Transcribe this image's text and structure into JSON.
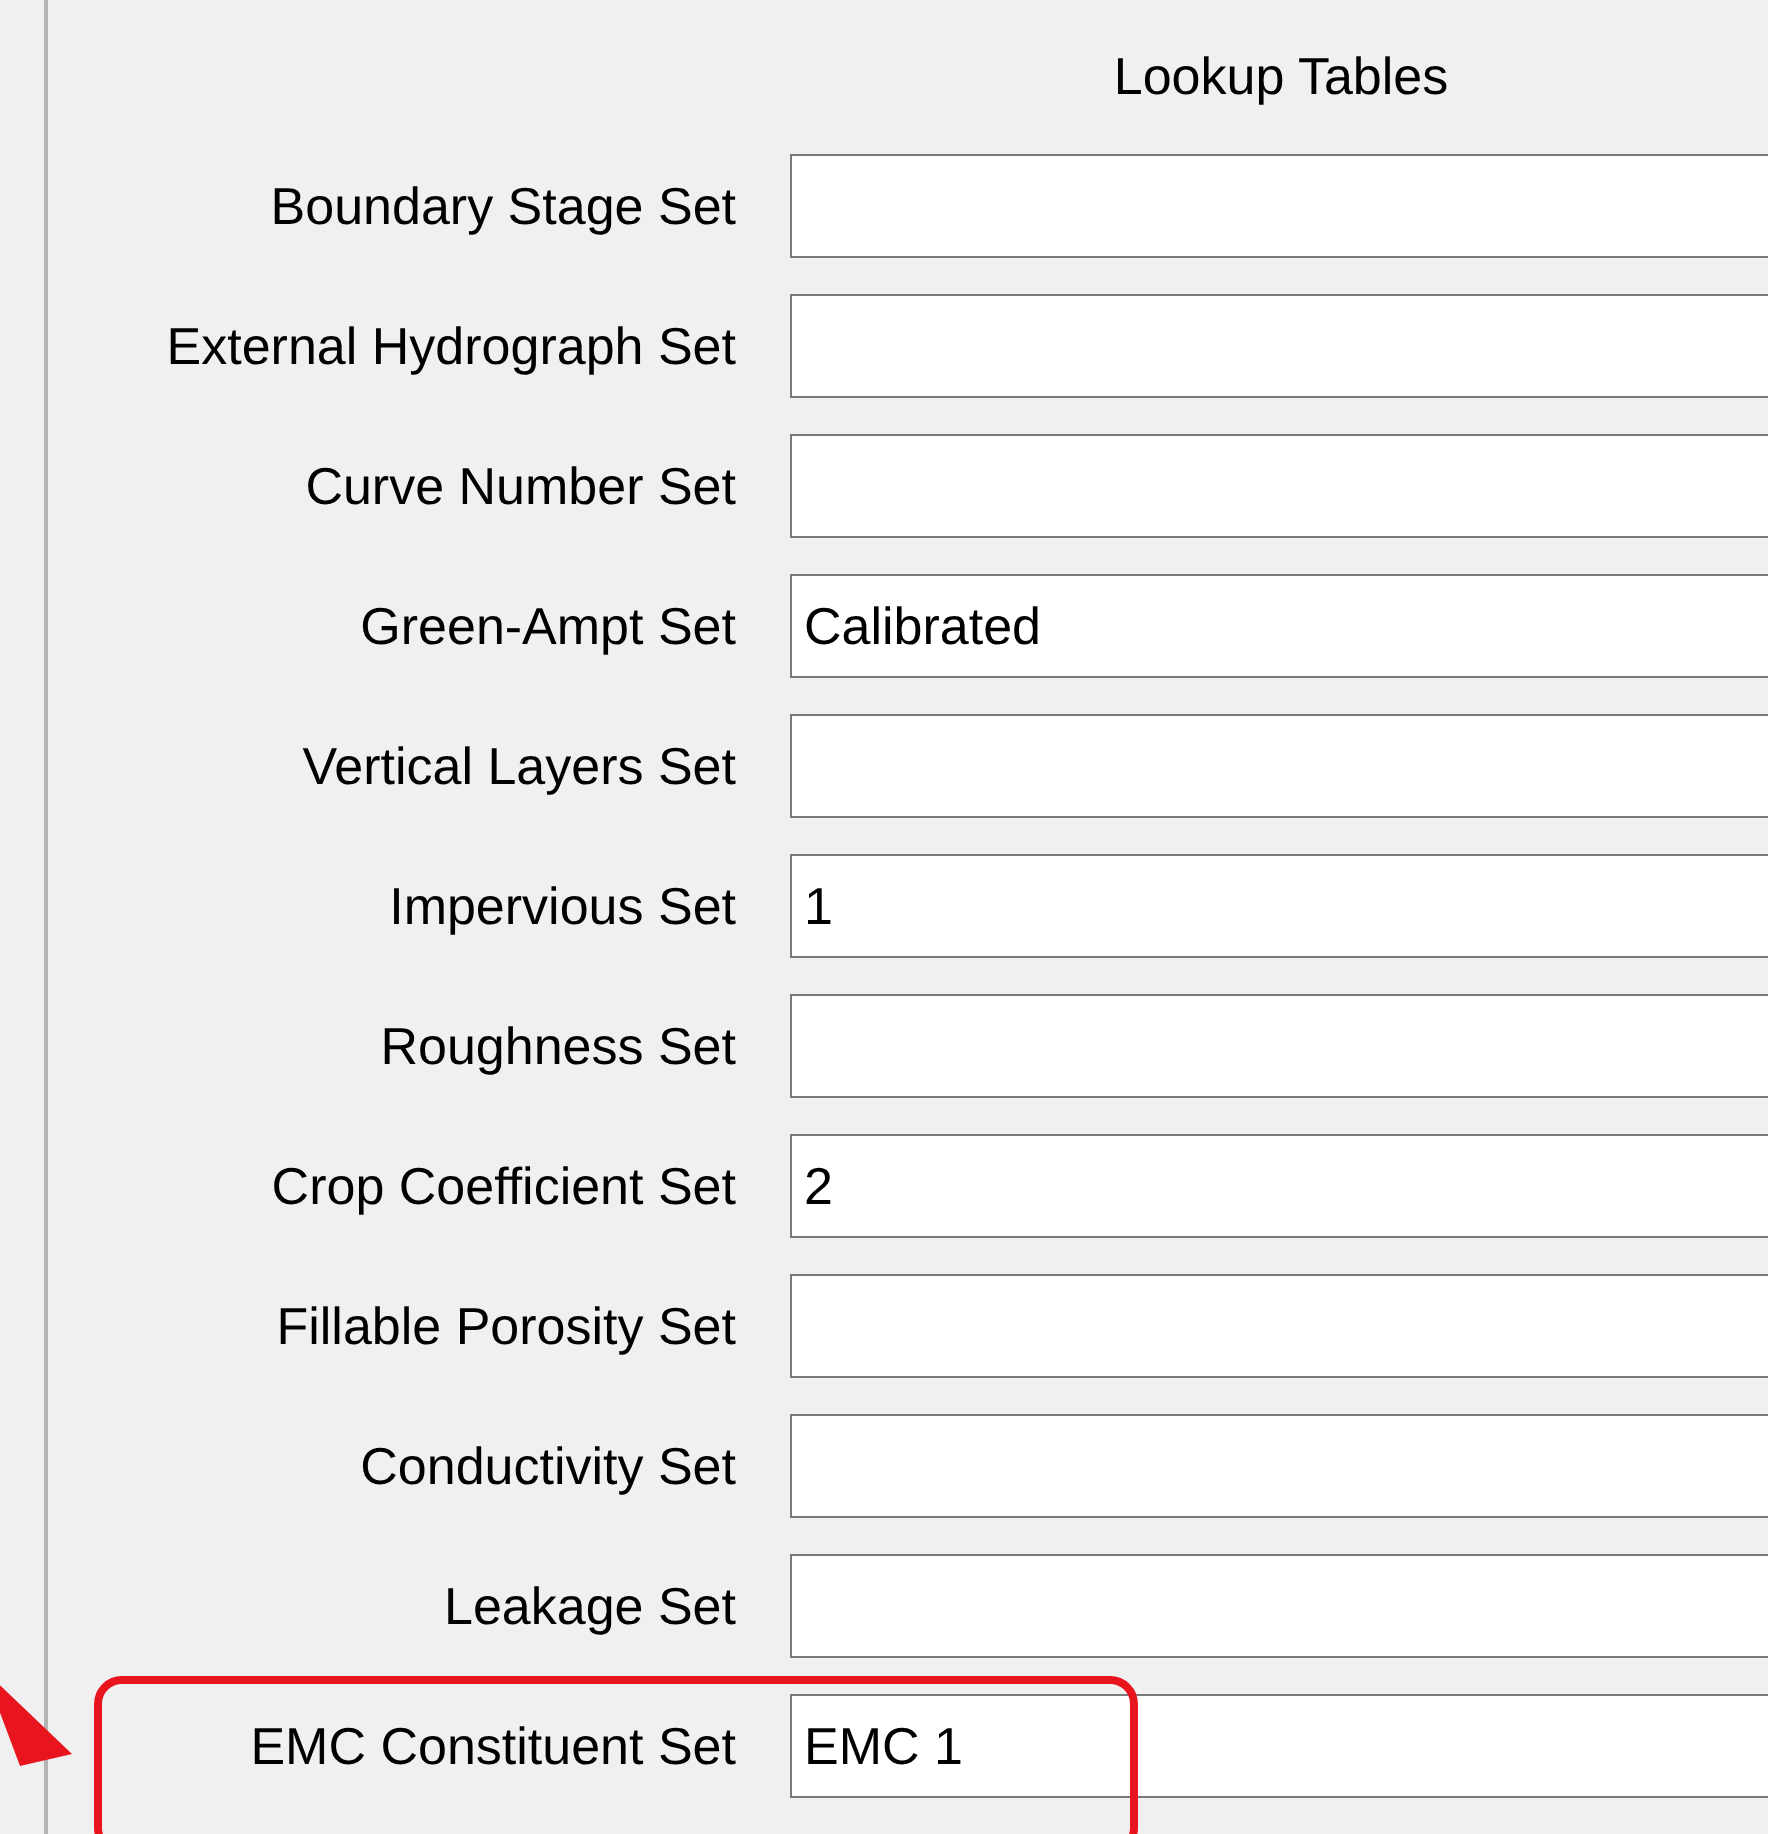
{
  "panel": {
    "title": "Lookup Tables"
  },
  "fields": [
    {
      "label": "Boundary Stage Set",
      "highlighted": false
    },
    {
      "label": "External Hydrograph Set",
      "highlighted": false
    },
    {
      "label": "Curve Number Set",
      "highlighted": false
    },
    {
      "label": "Green-Ampt Set",
      "value": "Calibrated",
      "highlighted": false
    },
    {
      "label": "Vertical Layers Set",
      "highlighted": false
    },
    {
      "label": "Impervious Set",
      "value": "1",
      "highlighted": false
    },
    {
      "label": "Roughness Set",
      "highlighted": false
    },
    {
      "label": "Crop Coefficient Set",
      "value": "2",
      "highlighted": false
    },
    {
      "label": "Fillable Porosity Set",
      "highlighted": false
    },
    {
      "label": "Conductivity Set",
      "highlighted": false
    },
    {
      "label": "Leakage Set",
      "highlighted": false
    },
    {
      "label": "EMC Constituent Set",
      "value": "EMC 1",
      "highlighted": true
    }
  ]
}
